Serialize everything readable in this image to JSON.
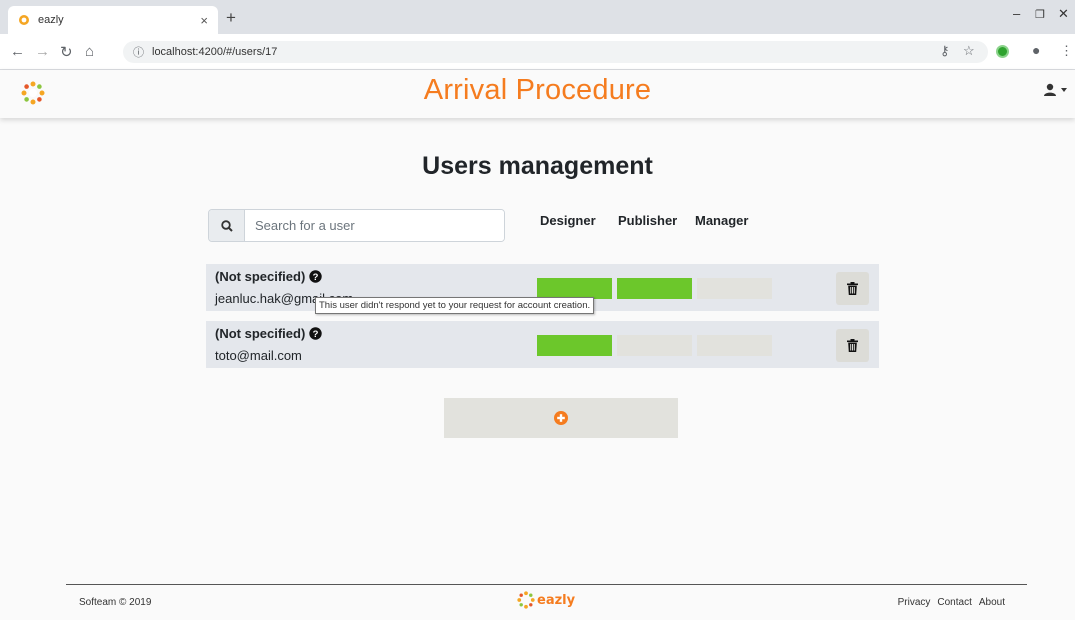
{
  "browser": {
    "tab_title": "eazly",
    "tab_close": "×",
    "new_tab": "+",
    "url": "localhost:4200/#/users/17",
    "window_controls": {
      "minimize": "–",
      "restore": "❐",
      "close": "✕"
    }
  },
  "header": {
    "title": "Arrival Procedure",
    "brand_color": "#f57c1f"
  },
  "main": {
    "heading": "Users management",
    "search": {
      "placeholder": "Search for a user",
      "value": ""
    },
    "roles": [
      "Designer",
      "Publisher",
      "Manager"
    ],
    "users": [
      {
        "name": "(Not specified)",
        "email": "jeanluc.hak@gmail.com",
        "roles": {
          "designer": true,
          "publisher": true,
          "manager": false
        }
      },
      {
        "name": "(Not specified)",
        "email": "toto@mail.com",
        "roles": {
          "designer": true,
          "publisher": false,
          "manager": false
        }
      }
    ],
    "tooltip": "This user didn't respond yet to your request for account creation.",
    "role_on_color": "#6cc72b",
    "role_off_color": "#e2e2dd"
  },
  "footer": {
    "copyright": "Softeam © 2019",
    "logo_text": "eazly",
    "links": [
      "Privacy",
      "Contact",
      "About"
    ]
  }
}
